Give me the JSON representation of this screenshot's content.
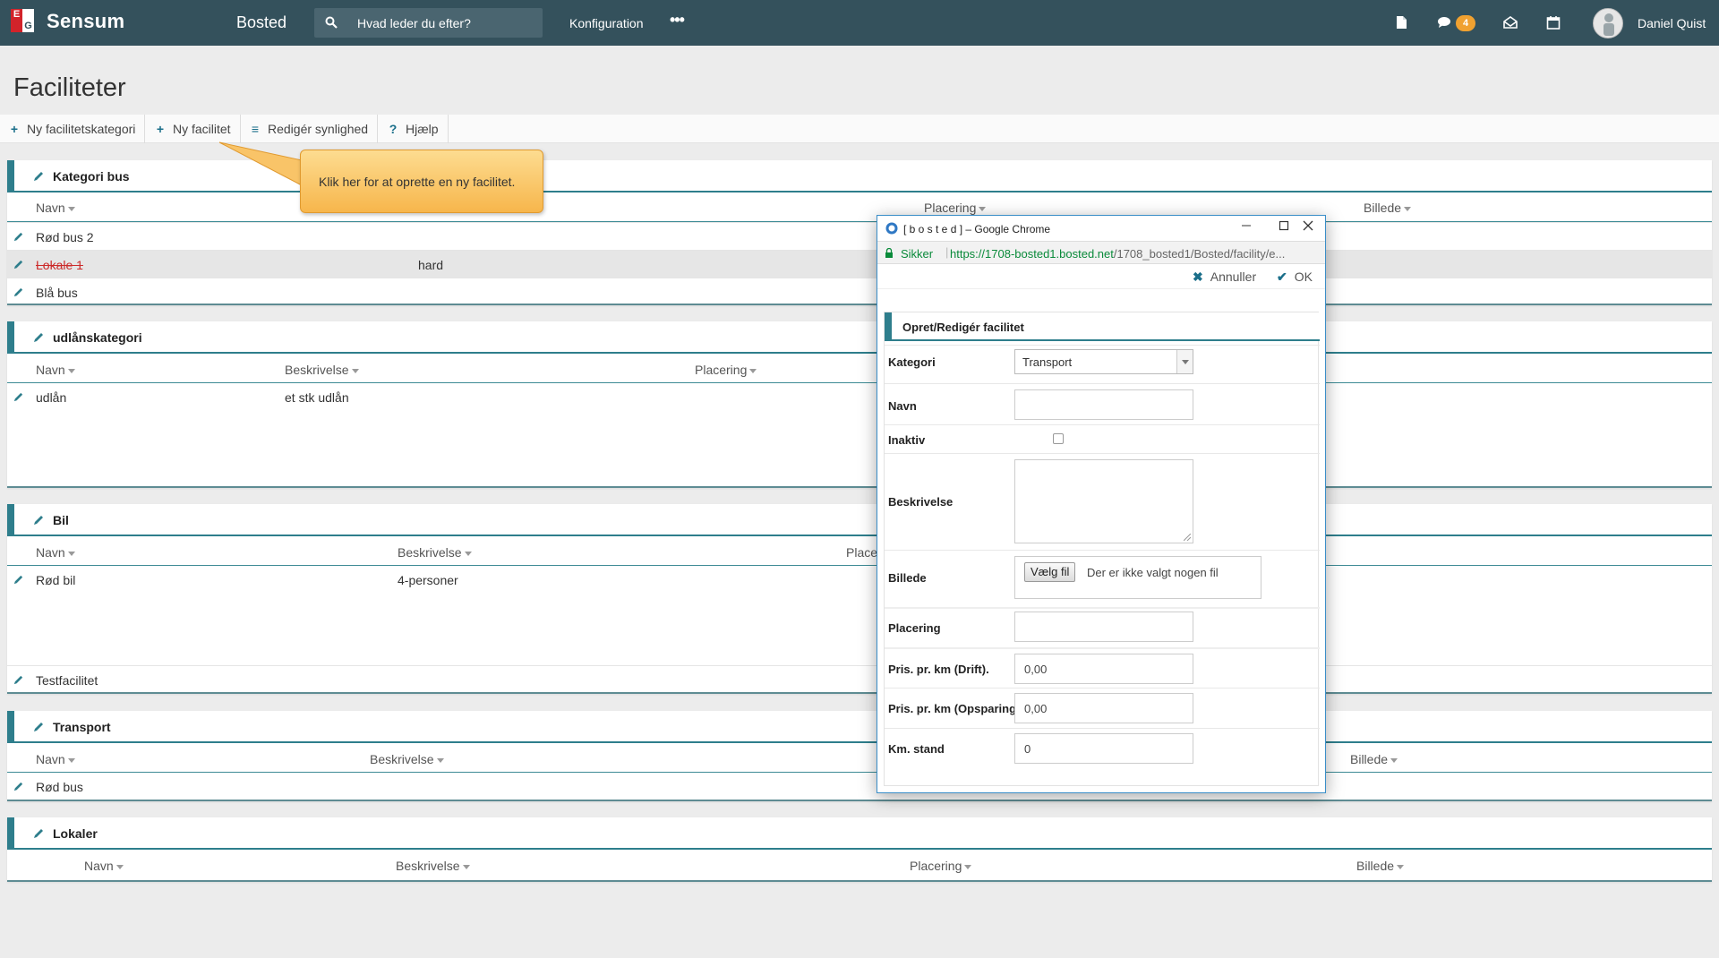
{
  "topbar": {
    "brand": "Sensum",
    "logo_letters": [
      "E",
      "G"
    ],
    "app_name": "Bosted",
    "search_placeholder": "Hvad leder du efter?",
    "nav_configuration": "Konfiguration",
    "nav_more": "•••",
    "chat_badge": "4",
    "user_name": "Daniel Quist",
    "colors": {
      "bar": "#34515c",
      "badge": "#f0a130",
      "logo_red": "#d2232a"
    }
  },
  "page": {
    "title": "Faciliteter",
    "toolbar": [
      {
        "icon": "plus-icon",
        "label": "Ny facilitetskategori"
      },
      {
        "icon": "plus-icon",
        "label": "Ny facilitet"
      },
      {
        "icon": "sliders-icon",
        "label": "Redigér synlighed"
      },
      {
        "icon": "question-icon",
        "label": "Hjælp"
      }
    ]
  },
  "tooltip": {
    "text": "Klik her for at oprette en ny facilitet."
  },
  "panels": [
    {
      "title": "Kategori bus",
      "columns": [
        "Navn",
        "Placering",
        "Billede"
      ],
      "rows": [
        {
          "name": "Rød bus 2",
          "desc": ""
        },
        {
          "name": "Lokale 1",
          "desc": "hard",
          "inactive": true
        },
        {
          "name": "Blå bus",
          "desc": ""
        }
      ]
    },
    {
      "title": "udlånskategori",
      "columns": [
        "Navn",
        "Beskrivelse",
        "Placering"
      ],
      "rows": [
        {
          "name": "udlån",
          "desc": "et stk udlån"
        }
      ]
    },
    {
      "title": "Bil",
      "columns": [
        "Navn",
        "Beskrivelse",
        "Place"
      ],
      "rows": [
        {
          "name": "Rød bil",
          "desc": "4-personer"
        },
        {
          "name": "Testfacilitet",
          "desc": ""
        }
      ]
    },
    {
      "title": "Transport",
      "columns": [
        "Navn",
        "Beskrivelse",
        "Billede"
      ],
      "rows": [
        {
          "name": "Rød bus",
          "desc": ""
        }
      ]
    },
    {
      "title": "Lokaler",
      "columns": [
        "Navn",
        "Beskrivelse",
        "Placering",
        "Billede"
      ],
      "rows": []
    }
  ],
  "popup": {
    "window_title": "[ b o s t e d ] – Google Chrome",
    "secure_label": "Sikker",
    "url_host": "https://1708-bosted1.bosted.net",
    "url_path": "/1708_bosted1/Bosted/facility/e...",
    "cancel_label": "Annuller",
    "ok_label": "OK",
    "form_title": "Opret/Redigér facilitet",
    "fields": {
      "kategori_label": "Kategori",
      "kategori_value": "Transport",
      "navn_label": "Navn",
      "navn_value": "",
      "inaktiv_label": "Inaktiv",
      "inaktiv_checked": false,
      "beskrivelse_label": "Beskrivelse",
      "billede_label": "Billede",
      "billede_button": "Vælg fil",
      "billede_status": "Der er ikke valgt nogen fil",
      "placering_label": "Placering",
      "placering_value": "",
      "pris_drift_label": "Pris. pr. km (Drift).",
      "pris_drift_value": "0,00",
      "pris_opsparing_label": "Pris. pr. km (Opsparing).",
      "pris_opsparing_value": "0,00",
      "km_label": "Km. stand",
      "km_value": "0"
    }
  }
}
